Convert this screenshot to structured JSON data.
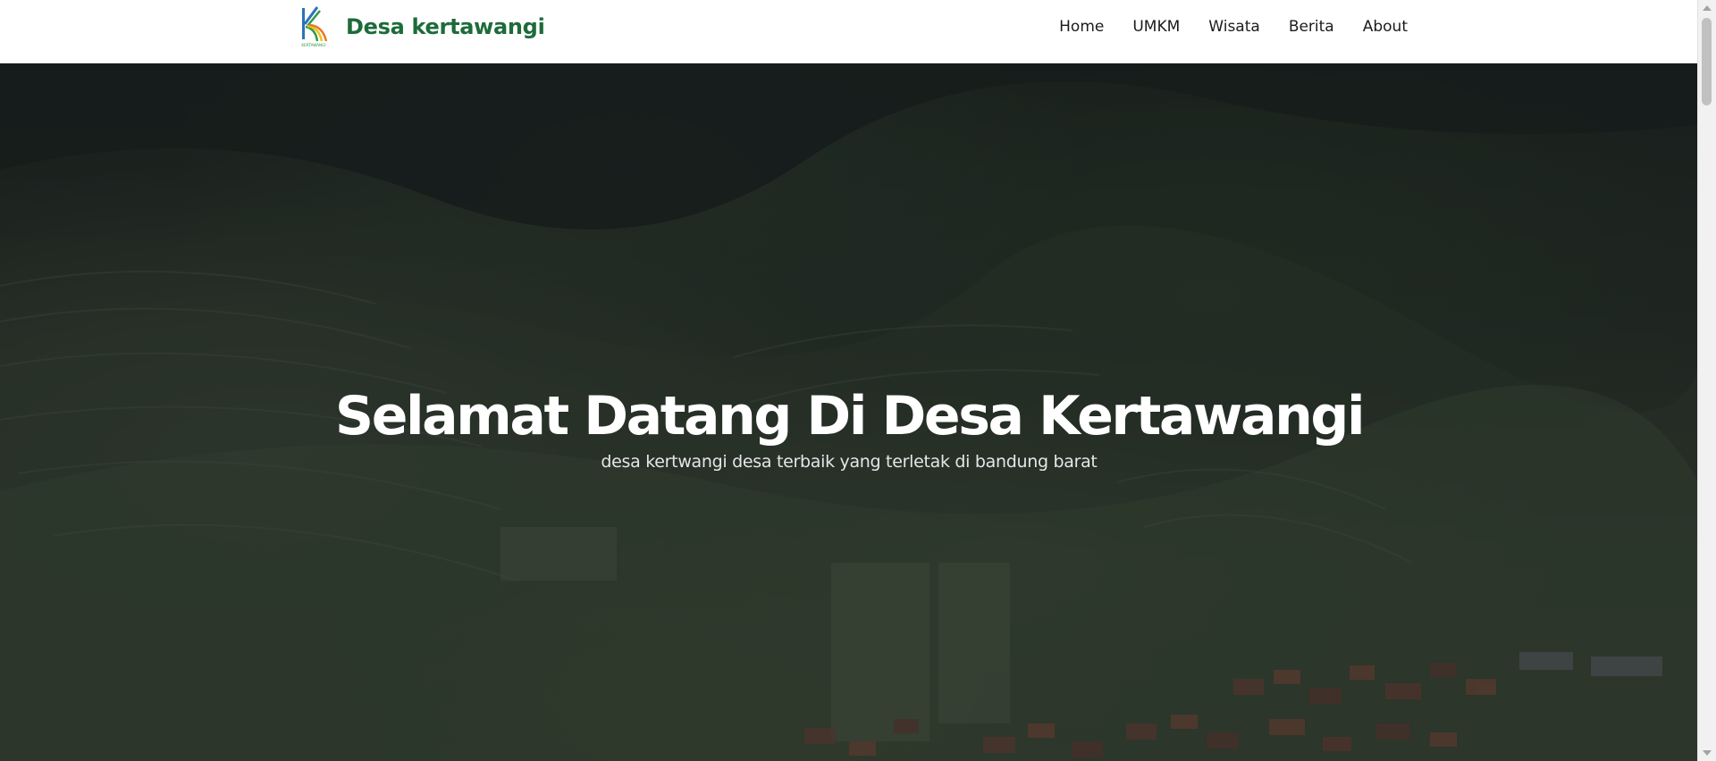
{
  "header": {
    "brand_name": "Desa kertawangi",
    "logo_icon": "kertawangi-k-logo-icon",
    "logo_text": "KERTAWANGI",
    "nav": [
      {
        "label": "Home"
      },
      {
        "label": "UMKM"
      },
      {
        "label": "Wisata"
      },
      {
        "label": "Berita"
      },
      {
        "label": "About"
      }
    ]
  },
  "hero": {
    "title": "Selamat Datang Di Desa Kertawangi",
    "subtitle": "desa kertwangi desa terbaik yang terletak di bandung barat",
    "background_image": "aerial view of terraced green hills with village rooftops, dark overlay"
  },
  "colors": {
    "brand": "#1e6b3a",
    "nav_text": "#1b1b1b",
    "hero_title": "#ffffff",
    "hero_subtitle": "#e4e6e8",
    "logo_colors": [
      "#2a73b8",
      "#2f9a4a",
      "#f0c419",
      "#e8782c"
    ]
  }
}
